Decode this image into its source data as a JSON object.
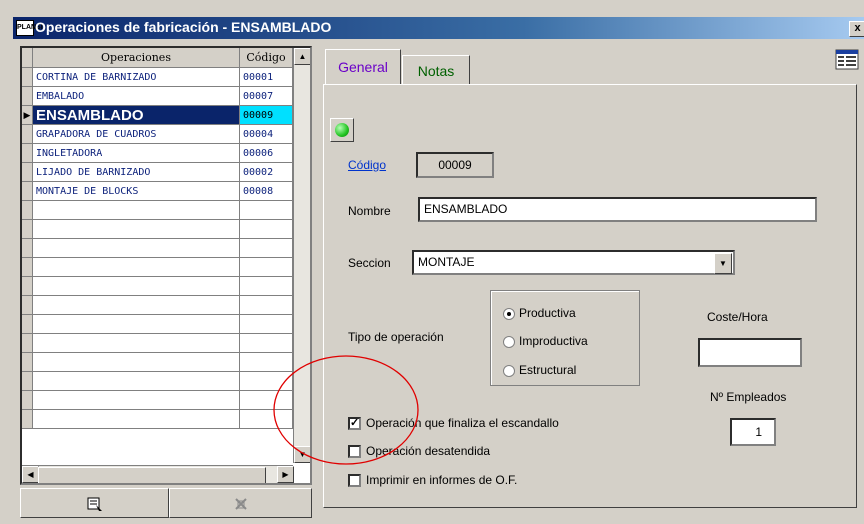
{
  "window": {
    "title": "Operaciones de fabricación - ENSAMBLADO",
    "title_icon": "app-icon",
    "close_label": "x"
  },
  "grid": {
    "columns": [
      "Operaciones",
      "Código"
    ],
    "rows": [
      {
        "name": "CORTINA DE BARNIZADO",
        "code": "00001",
        "selected": false
      },
      {
        "name": "EMBALADO",
        "code": "00007",
        "selected": false
      },
      {
        "name": "ENSAMBLADO",
        "code": "00009",
        "selected": true
      },
      {
        "name": "GRAPADORA DE CUADROS",
        "code": "00004",
        "selected": false
      },
      {
        "name": "INGLETADORA",
        "code": "00006",
        "selected": false
      },
      {
        "name": "LIJADO DE BARNIZADO",
        "code": "00002",
        "selected": false
      },
      {
        "name": "MONTAJE DE BLOCKS",
        "code": "00008",
        "selected": false
      }
    ],
    "empty_rows": 12,
    "selected_indicator": "▶"
  },
  "toolbar": {
    "edit_icon": "edit-record-icon",
    "delete_icon": "delete-record-icon"
  },
  "tabs": [
    {
      "label": "General",
      "active": true
    },
    {
      "label": "Notas",
      "active": false
    }
  ],
  "form": {
    "codigo_label": "Código",
    "codigo_value": "00009",
    "nombre_label": "Nombre",
    "nombre_value": "ENSAMBLADO",
    "seccion_label": "Seccion",
    "seccion_value": "MONTAJE",
    "tipo_label": "Tipo de operación",
    "tipo_options": [
      {
        "label": "Productiva",
        "checked": true
      },
      {
        "label": "Improductiva",
        "checked": false
      },
      {
        "label": "Estructural",
        "checked": false
      }
    ],
    "coste_label": "Coste/Hora",
    "coste_value": "",
    "empleados_label": "Nº Empleados",
    "empleados_value": "1",
    "checkboxes": [
      {
        "label": "Operación que finaliza el escandallo",
        "checked": true
      },
      {
        "label": "Operación desatendida",
        "checked": false
      },
      {
        "label": "Imprimir en informes de O.F.",
        "checked": false
      }
    ]
  },
  "colors": {
    "accent": "#0a246a",
    "highlight_code": "#00e0ff",
    "status_led": "#22c422",
    "annotation_circle": "#e00000",
    "tab_active_text": "#6a00c8",
    "tab_inactive_text": "#006000"
  }
}
